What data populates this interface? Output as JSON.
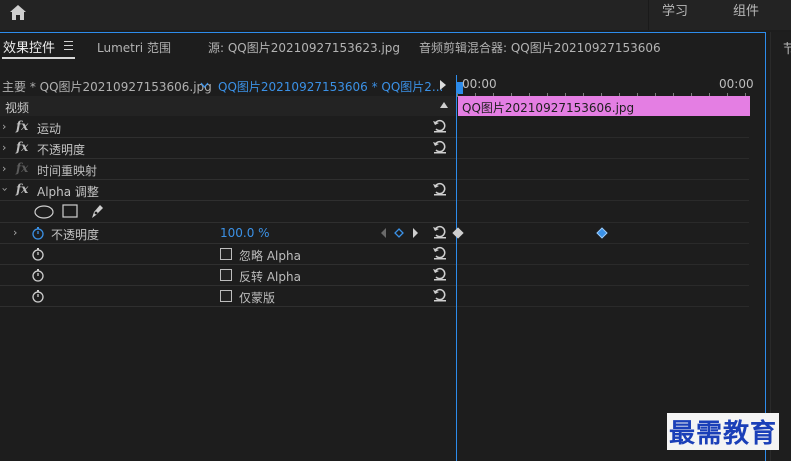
{
  "topbar": {
    "workspace_tabs": [
      "学习",
      "组件"
    ]
  },
  "right_panel": {
    "partial_label": "节"
  },
  "tabs": {
    "effect_controls": "效果控件",
    "lumetri": "Lumetri 范围",
    "source": "源: QQ图片20210927153623.jpg",
    "audio_mixer": "音频剪辑混合器: QQ图片20210927153606"
  },
  "sequence": {
    "master": "主要 * QQ图片20210927153606.jpg",
    "clip": "QQ图片20210927153606 * QQ图片2..."
  },
  "section": {
    "video_label": "视频"
  },
  "effects": [
    {
      "name": "运动",
      "fx_enabled": true
    },
    {
      "name": "不透明度",
      "fx_enabled": true
    },
    {
      "name": "时间重映射",
      "fx_enabled": false
    },
    {
      "name": "Alpha 调整",
      "fx_enabled": true
    }
  ],
  "alpha_adjust": {
    "opacity_label": "不透明度",
    "opacity_value": "100.0 %",
    "ignore_alpha": "忽略 Alpha",
    "invert_alpha": "反转 Alpha",
    "mask_only": "仅蒙版"
  },
  "timeline": {
    "start_tc": "00:00",
    "end_tc": "00:00",
    "clip_name": "QQ图片20210927153606.jpg"
  },
  "watermark": "最需教育",
  "colors": {
    "accent": "#2d8ceb",
    "value_blue": "#3b91e6",
    "clip_pink": "#e47ee3"
  }
}
